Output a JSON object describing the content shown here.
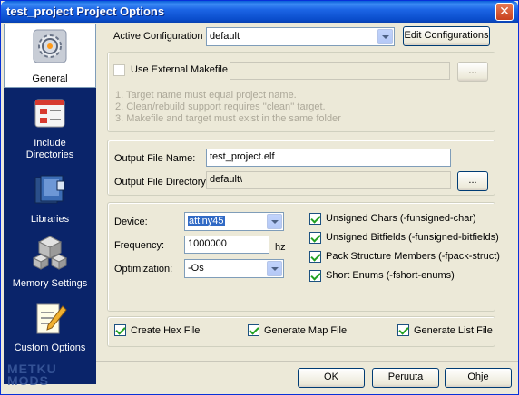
{
  "window": {
    "title": "test_project Project Options"
  },
  "sidebar": {
    "items": [
      {
        "label": "General",
        "icon": "gear-icon"
      },
      {
        "label": "Include\nDirectories",
        "icon": "include-directories-icon"
      },
      {
        "label": "Libraries",
        "icon": "books-icon"
      },
      {
        "label": "Memory Settings",
        "icon": "cubes-icon"
      },
      {
        "label": "Custom Options",
        "icon": "notepad-pencil-icon"
      }
    ],
    "watermark": "METKU\nMODS"
  },
  "config": {
    "label": "Active Configuration",
    "value": "default",
    "edit_button": "Edit Configurations"
  },
  "makefile": {
    "checkbox_label": "Use External Makefile",
    "browse": "...",
    "notes": [
      "1. Target name must equal project name.",
      "2. Clean/rebuild support requires ''clean'' target.",
      "3. Makefile and target must exist in the same folder"
    ]
  },
  "output": {
    "file_label": "Output File Name:",
    "file_value": "test_project.elf",
    "dir_label": "Output File Directory:",
    "dir_value": "default\\",
    "browse": "..."
  },
  "device": {
    "device_label": "Device:",
    "device_value": "attiny45",
    "freq_label": "Frequency:",
    "freq_value": "1000000",
    "freq_unit": "hz",
    "opt_label": "Optimization:",
    "opt_value": "-Os"
  },
  "flags": [
    {
      "label": "Unsigned Chars (-funsigned-char)",
      "checked": true
    },
    {
      "label": "Unsigned Bitfields (-funsigned-bitfields)",
      "checked": true
    },
    {
      "label": "Pack Structure Members (-fpack-struct)",
      "checked": true
    },
    {
      "label": "Short Enums (-fshort-enums)",
      "checked": true
    }
  ],
  "outputs": {
    "hex": "Create Hex File",
    "map": "Generate Map File",
    "list": "Generate List File"
  },
  "buttons": {
    "ok": "OK",
    "cancel": "Peruuta",
    "help": "Ohje"
  }
}
